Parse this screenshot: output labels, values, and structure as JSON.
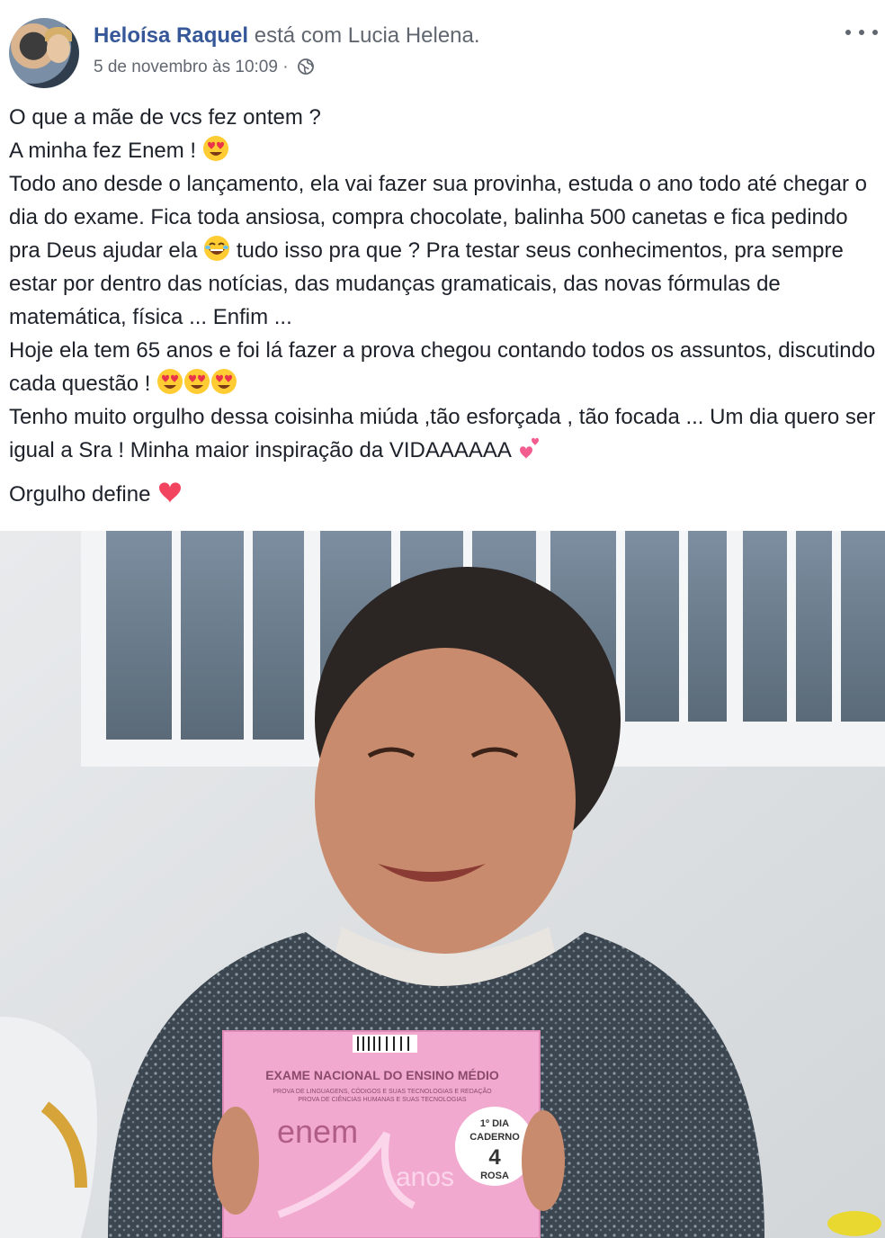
{
  "post": {
    "author": "Heloísa Raquel",
    "with_text": "está com",
    "tagged_user": "Lucia Helena.",
    "timestamp": "5 de novembro às 10:09",
    "separator": "·",
    "privacy_icon": "globe-icon",
    "more_icon": "more-options-icon"
  },
  "text": {
    "line1": "O que a mãe de vcs fez ontem ?",
    "line2": "A minha fez Enem !",
    "line3": "Todo ano desde o lançamento, ela vai fazer sua provinha, estuda o ano todo até chegar o dia do exame. Fica toda ansiosa, compra chocolate, balinha 500 canetas e fica pedindo pra Deus ajudar ela",
    "line3b": "tudo isso pra que ? Pra testar seus conhecimentos, pra sempre estar por dentro das notícias, das mudanças gramaticais, das novas fórmulas de matemática, física ... Enfim ...",
    "line4": "Hoje ela tem 65 anos e foi lá fazer a prova chegou contando todos os assuntos, discutindo cada questão !",
    "line5": "Tenho muito orgulho dessa coisinha miúda ,tão esforçada , tão focada ... Um dia quero ser igual a Sra ! Minha maior inspiração da VIDAAAAAA",
    "line6": "Orgulho define"
  },
  "photo": {
    "booklet_title": "EXAME NACIONAL DO ENSINO MÉDIO",
    "booklet_sub1": "PROVA DE LINGUAGENS, CÓDIGOS E SUAS TECNOLOGIAS E REDAÇÃO",
    "booklet_sub2": "PROVA DE CIÊNCIAS HUMANAS E SUAS TECNOLOGIAS",
    "logo": "enem",
    "logo_years": "anos",
    "badge_day": "1º DIA",
    "badge_label": "CADERNO",
    "badge_number": "4",
    "badge_color": "ROSA"
  },
  "colors": {
    "author": "#365899",
    "meta": "#616770",
    "text": "#1d2129",
    "booklet": "#f2a9cf"
  }
}
